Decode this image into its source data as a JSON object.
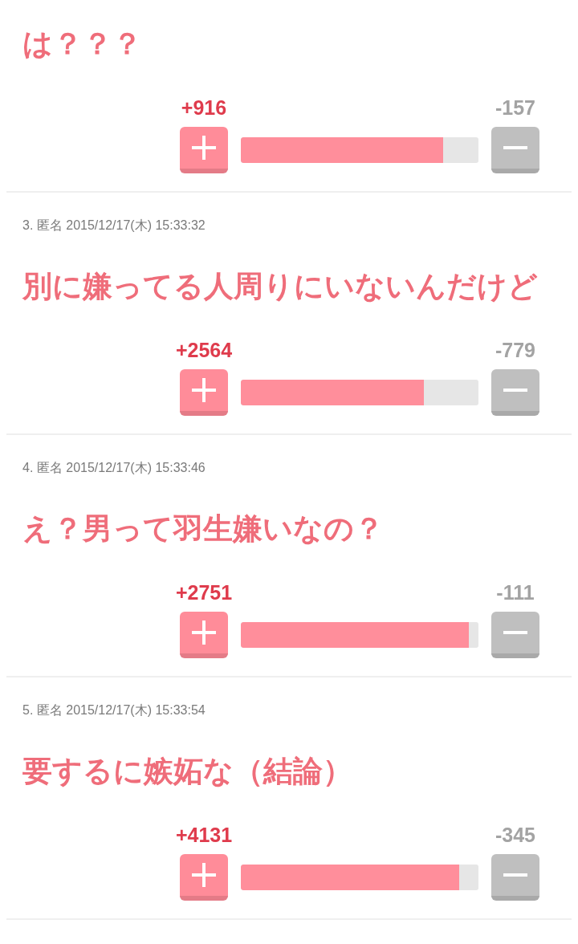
{
  "comments": [
    {
      "title": "は？？？",
      "upvotes": "+916",
      "downvotes": "-157",
      "level": 0.85
    },
    {
      "meta": "3. 匿名 2015/12/17(木) 15:33:32",
      "title": "別に嫌ってる人周りにいないんだけど",
      "upvotes": "+2564",
      "downvotes": "-779",
      "level": 0.77
    },
    {
      "meta": "4. 匿名 2015/12/17(木) 15:33:46",
      "title": "え？男って羽生嫌いなの？",
      "upvotes": "+2751",
      "downvotes": "-111",
      "level": 0.96
    },
    {
      "meta": "5. 匿名 2015/12/17(木) 15:33:54",
      "title": "要するに嫉妬な（結論）",
      "upvotes": "+4131",
      "downvotes": "-345",
      "level": 0.92
    }
  ]
}
